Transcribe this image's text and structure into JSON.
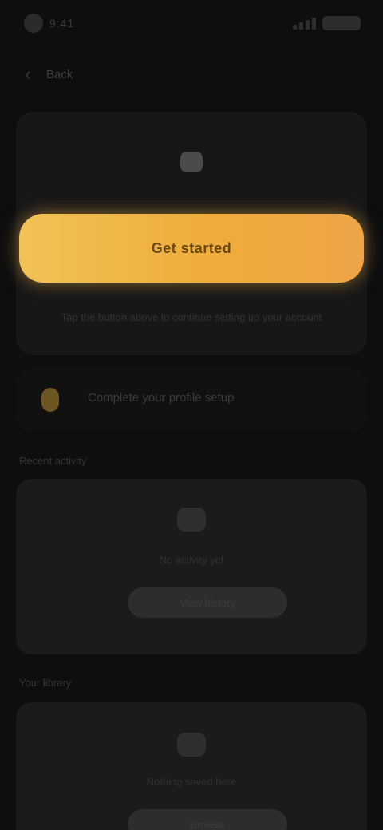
{
  "status_bar": {
    "time": "9:41",
    "signal_icon": "signal-bars-icon",
    "battery_icon": "battery-icon"
  },
  "nav": {
    "back_icon": "chevron-left-icon",
    "title": "Back"
  },
  "main_card": {
    "icon": "sparkle-icon",
    "cta_label": "Get started",
    "caption": "Tap the button above to continue setting up your account"
  },
  "info_row": {
    "icon": "bolt-icon",
    "text": "Complete your profile setup"
  },
  "sections": [
    {
      "header": "Recent activity",
      "icon": "clock-icon",
      "text": "No activity yet",
      "button_label": "View history"
    },
    {
      "header": "Your library",
      "icon": "folder-icon",
      "text": "Nothing saved here",
      "button_label": "Browse"
    }
  ],
  "colors": {
    "background": "#0e0e0f",
    "card": "#171718",
    "accent_start": "#f1c257",
    "accent_end": "#eda548"
  }
}
